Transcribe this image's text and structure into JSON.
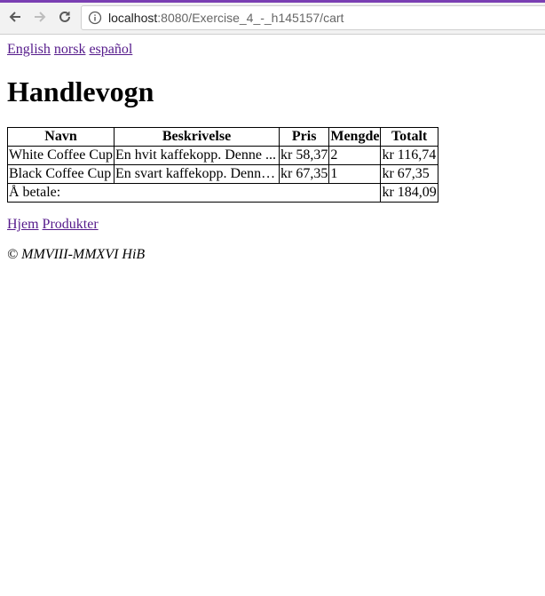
{
  "browser": {
    "url_host": "localhost",
    "url_path": ":8080/Exercise_4_-_h145157/cart"
  },
  "languages": [
    "English",
    "norsk",
    "español"
  ],
  "page_title": "Handlevogn",
  "table": {
    "headers": [
      "Navn",
      "Beskrivelse",
      "Pris",
      "Mengde",
      "Totalt"
    ],
    "rows": [
      [
        "White Coffee Cup",
        "En hvit kaffekopp. Denne ...",
        "kr 58,37",
        "2",
        "kr 116,74"
      ],
      [
        "Black Coffee Cup",
        "En svart kaffekopp. Denne...",
        "kr 67,35",
        "1",
        "kr 67,35"
      ]
    ],
    "total_label": "Å betale:",
    "total_value": "kr 184,09"
  },
  "nav_links": [
    "Hjem",
    "Produkter"
  ],
  "footer": "© MMVIII-MMXVI HiB"
}
